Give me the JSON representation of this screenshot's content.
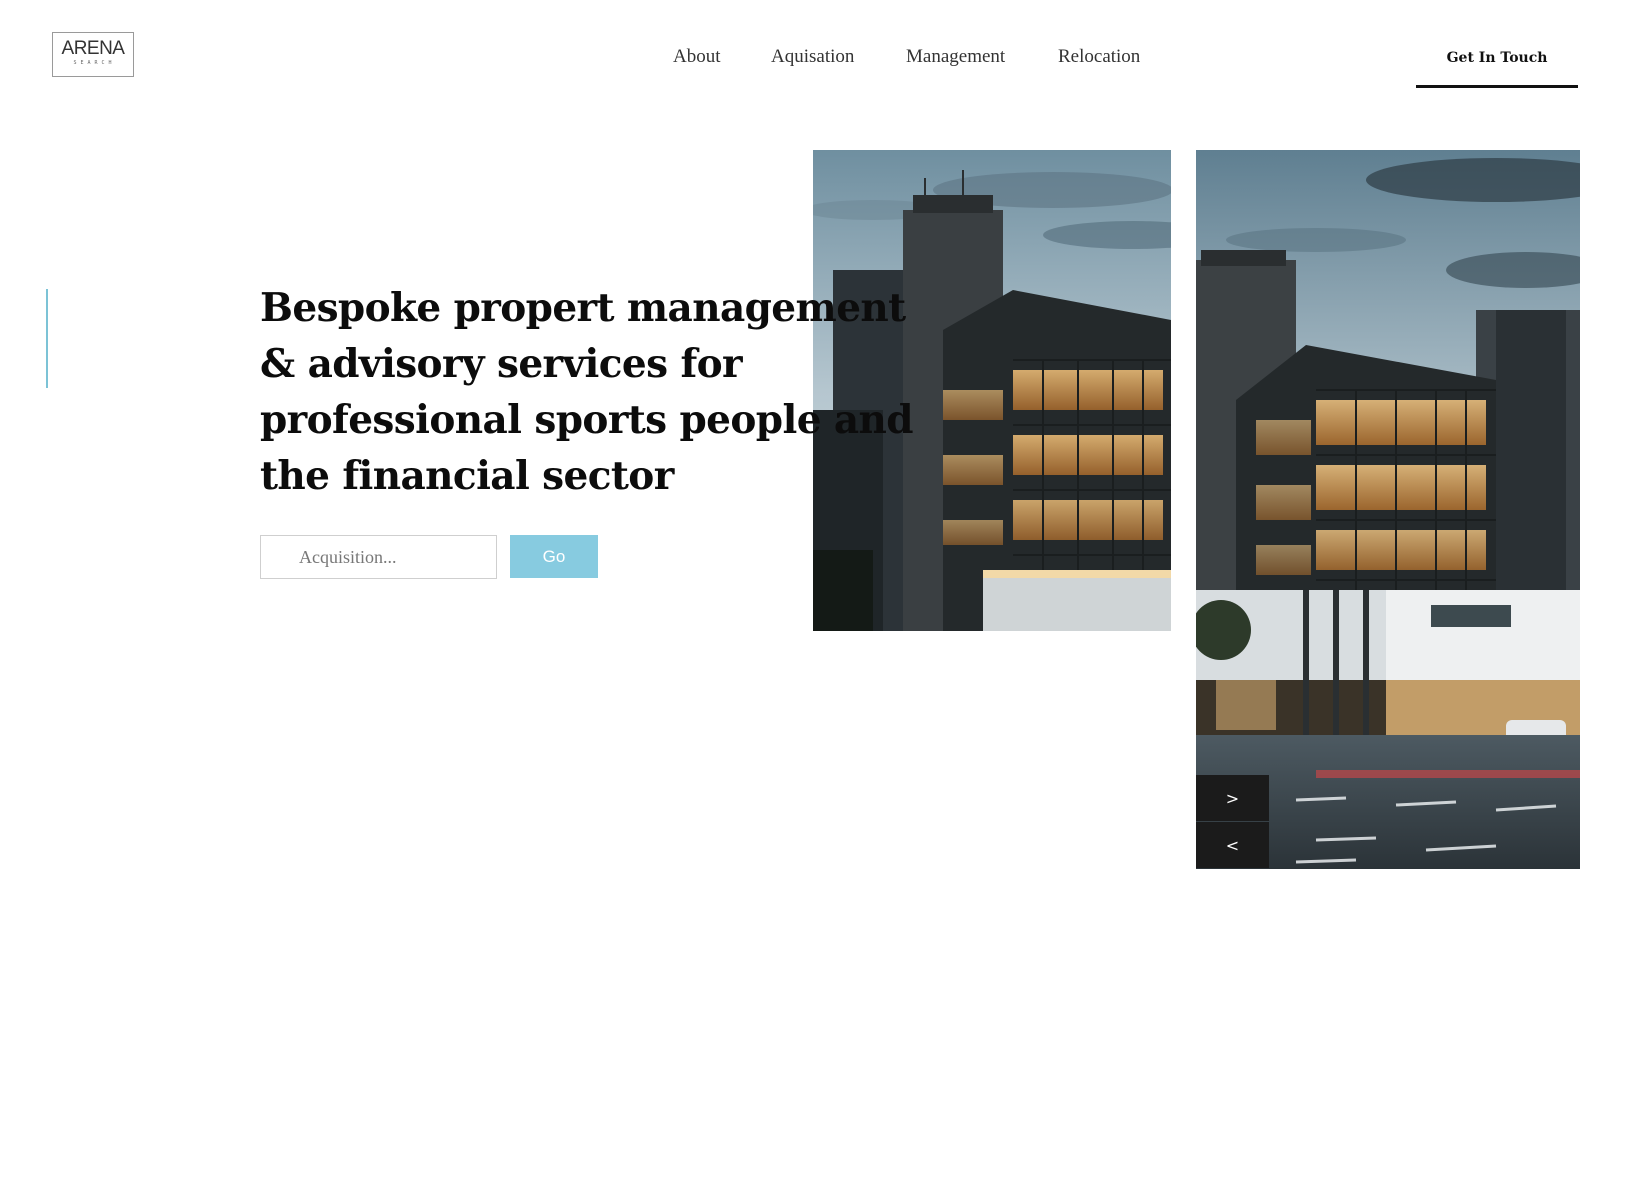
{
  "header": {
    "logo": {
      "main": "ARENA",
      "sub": "SEARCH"
    },
    "nav": [
      {
        "label": "About"
      },
      {
        "label": "Aquisation"
      },
      {
        "label": "Management"
      },
      {
        "label": "Relocation"
      }
    ],
    "cta_label": "Get In Touch"
  },
  "hero": {
    "headline_lines": [
      "Bespoke propert management",
      "& advisory services for",
      "professional sports people and",
      "the financial sector"
    ],
    "search": {
      "placeholder": "Acquisition...",
      "value": ""
    },
    "go_label": "Go"
  },
  "slider": {
    "next_label": ">",
    "prev_label": "<"
  },
  "colors": {
    "accent": "#87cbe0",
    "accent_line": "#7cc3d6",
    "dark": "#1b1b1b"
  }
}
